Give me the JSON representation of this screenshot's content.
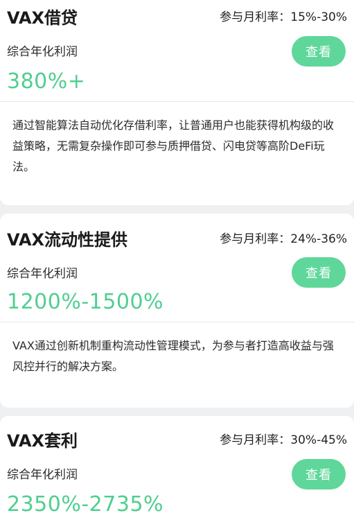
{
  "products": [
    {
      "title": "VAX借贷",
      "monthly_rate_label": "参与月利率：",
      "monthly_rate": "15%-30%",
      "yield_label": "综合年化利润",
      "yield_value": "380%+",
      "view_label": "查看",
      "description": "通过智能算法自动优化存借利率，让普通用户也能获得机构级的收益策略，无需复杂操作即可参与质押借贷、闪电贷等高阶DeFi玩法。"
    },
    {
      "title": "VAX流动性提供",
      "monthly_rate_label": "参与月利率：",
      "monthly_rate": "24%-36%",
      "yield_label": "综合年化利润",
      "yield_value": "1200%-1500%",
      "view_label": "查看",
      "description": "VAX通过创新机制重构流动性管理模式，为参与者打造高收益与强风控并行的解决方案。"
    },
    {
      "title": "VAX套利",
      "monthly_rate_label": "参与月利率：",
      "monthly_rate": "30%-45%",
      "yield_label": "综合年化利润",
      "yield_value": "2350%-2735%",
      "view_label": "查看"
    }
  ],
  "colors": {
    "accent_green": "#4fcf8f",
    "button_green": "#5fd79a",
    "page_background": "#eef0f2"
  }
}
